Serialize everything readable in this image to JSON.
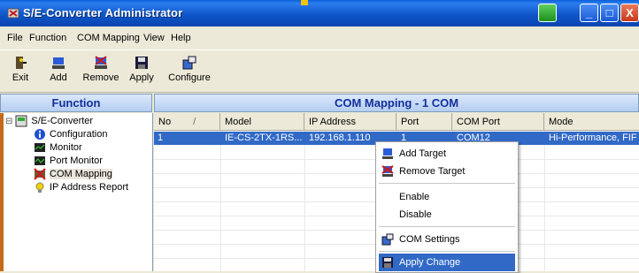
{
  "window": {
    "title": "S/E-Converter Administrator",
    "close_glyph": "X",
    "maximize_glyph": "□",
    "minimize_glyph": "_"
  },
  "menu": [
    "File",
    "Function",
    "COM Mapping",
    "View",
    "Help"
  ],
  "toolbar": [
    {
      "label": "Exit",
      "icon": "exit-icon"
    },
    {
      "label": "Add",
      "icon": "add-icon"
    },
    {
      "label": "Remove",
      "icon": "remove-icon"
    },
    {
      "label": "Apply",
      "icon": "apply-icon"
    },
    {
      "label": "Configure",
      "icon": "configure-icon"
    }
  ],
  "function_panel": {
    "header": "Function",
    "tree": [
      {
        "label": "S/E-Converter",
        "icon": "converter-icon",
        "expander": "⊟"
      },
      {
        "label": "Configuration",
        "icon": "info-icon"
      },
      {
        "label": "Monitor",
        "icon": "monitor-icon"
      },
      {
        "label": "Port Monitor",
        "icon": "port-monitor-icon"
      },
      {
        "label": "COM Mapping",
        "icon": "com-mapping-icon"
      },
      {
        "label": "IP Address Report",
        "icon": "ip-report-icon"
      }
    ]
  },
  "main": {
    "header": "COM Mapping - 1 COM",
    "columns": [
      "No",
      "Model",
      "IP Address",
      "Port",
      "COM Port",
      "Mode"
    ],
    "sort_indicator": "/",
    "rows": [
      {
        "no": "1",
        "model": "IE-CS-2TX-1RS...",
        "ip": "192.168.1.110",
        "port": "1",
        "com_port": "COM12",
        "mode": "Hi-Performance, FIFO"
      }
    ]
  },
  "context_menu": [
    {
      "label": "Add Target",
      "icon": "add-target-icon"
    },
    {
      "label": "Remove Target",
      "icon": "remove-target-icon"
    },
    {
      "label": "Enable"
    },
    {
      "label": "Disable"
    },
    {
      "label": "COM Settings",
      "icon": "com-settings-icon"
    },
    {
      "label": "Apply Change",
      "icon": "apply-change-icon",
      "highlighted": true
    }
  ],
  "colors": {
    "title_blue": "#0a5fd8",
    "selection": "#3169c6",
    "panel_header_text": "#11309a"
  }
}
